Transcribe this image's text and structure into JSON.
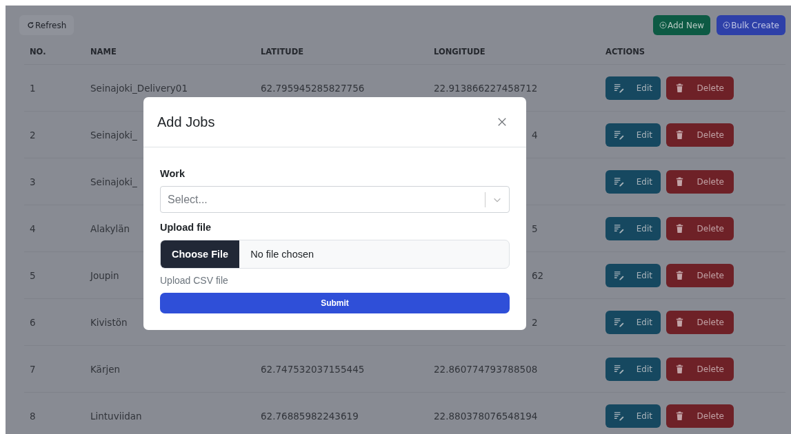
{
  "toolbar": {
    "refresh": "Refresh",
    "add_new": "Add New",
    "bulk_create": "Bulk Create"
  },
  "table": {
    "columns": [
      "NO.",
      "NAME",
      "LATITUDE",
      "LONGITUDE",
      "ACTIONS"
    ],
    "rows": [
      {
        "no": "1",
        "name": "Seinajoki_Delivery01",
        "latitude": "62.795945285827756",
        "longitude": "22.913866227458712",
        "covered": false,
        "edit": "Edit",
        "delete": "Delete"
      },
      {
        "no": "2",
        "name": "Seinajoki_",
        "longitude": "4",
        "covered": true,
        "edit": "Edit",
        "delete": "Delete"
      },
      {
        "no": "3",
        "name": "Seinajoki_",
        "edit": "Edit",
        "delete": "Delete"
      },
      {
        "no": "4",
        "name": "Alakylän",
        "longitude": "5",
        "covered": true,
        "edit": "Edit",
        "delete": "Delete"
      },
      {
        "no": "5",
        "name": "Joupin",
        "longitude": "62",
        "covered": true,
        "edit": "Edit",
        "delete": "Delete"
      },
      {
        "no": "6",
        "name": "Kivistön",
        "longitude": "2",
        "covered": true,
        "edit": "Edit",
        "delete": "Delete"
      },
      {
        "no": "7",
        "name": "Kärjen",
        "latitude": "62.747532037155445",
        "longitude": "22.860774793788508",
        "covered": false,
        "edit": "Edit",
        "delete": "Delete"
      },
      {
        "no": "8",
        "name": "Lintuviidan",
        "latitude": "62.76885982243619",
        "longitude": "22.880378076548194",
        "covered": false,
        "edit": "Edit",
        "delete": "Delete"
      }
    ]
  },
  "dialog": {
    "title": "Add Jobs",
    "work_label": "Work",
    "work_placeholder": "Select...",
    "upload_label": "Upload file",
    "choose_file": "Choose File",
    "file_status": "No file chosen",
    "help": "Upload CSV file",
    "submit": "Submit"
  }
}
